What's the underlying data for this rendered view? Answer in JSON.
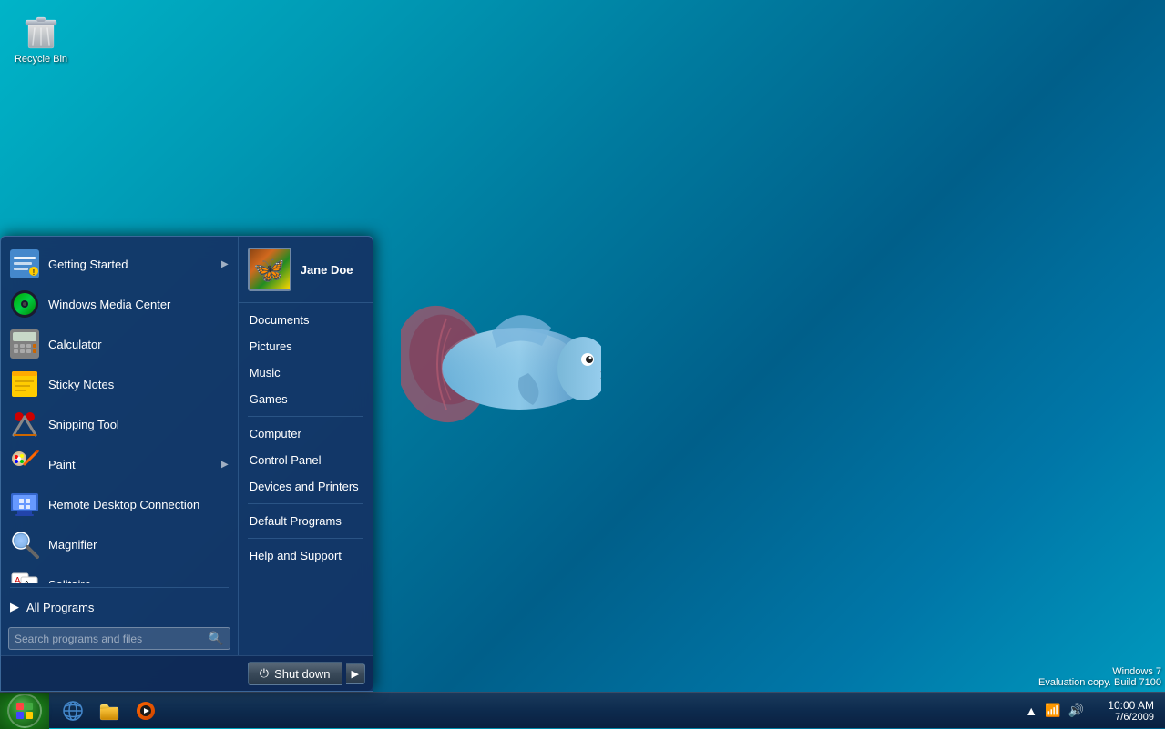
{
  "desktop": {
    "background": "Windows 7 fish wallpaper"
  },
  "recycle_bin": {
    "label": "Recycle Bin",
    "icon": "🗑"
  },
  "start_menu": {
    "user": {
      "name": "Jane Doe"
    },
    "left_items": [
      {
        "id": "getting-started",
        "label": "Getting Started",
        "icon": "📋",
        "has_arrow": true
      },
      {
        "id": "windows-media-center",
        "label": "Windows Media Center",
        "icon": "🎵",
        "has_arrow": false
      },
      {
        "id": "calculator",
        "label": "Calculator",
        "icon": "🧮",
        "has_arrow": false
      },
      {
        "id": "sticky-notes",
        "label": "Sticky Notes",
        "icon": "📝",
        "has_arrow": false
      },
      {
        "id": "snipping-tool",
        "label": "Snipping Tool",
        "icon": "✂",
        "has_arrow": false
      },
      {
        "id": "paint",
        "label": "Paint",
        "icon": "🖌",
        "has_arrow": true
      },
      {
        "id": "remote-desktop",
        "label": "Remote Desktop Connection",
        "icon": "🖥",
        "has_arrow": false
      },
      {
        "id": "magnifier",
        "label": "Magnifier",
        "icon": "🔍",
        "has_arrow": false
      },
      {
        "id": "solitaire",
        "label": "Solitaire",
        "icon": "🃏",
        "has_arrow": false
      }
    ],
    "all_programs_label": "All Programs",
    "search_placeholder": "Search programs and files",
    "right_items": [
      {
        "id": "documents",
        "label": "Documents"
      },
      {
        "id": "pictures",
        "label": "Pictures"
      },
      {
        "id": "music",
        "label": "Music"
      },
      {
        "id": "games",
        "label": "Games"
      },
      {
        "id": "computer",
        "label": "Computer"
      },
      {
        "id": "control-panel",
        "label": "Control Panel"
      },
      {
        "id": "devices-printers",
        "label": "Devices and Printers"
      },
      {
        "id": "default-programs",
        "label": "Default Programs"
      },
      {
        "id": "help-support",
        "label": "Help and Support"
      }
    ],
    "shutdown_label": "Shut down"
  },
  "taskbar": {
    "start_label": "Start",
    "pinned_icons": [
      {
        "id": "ie",
        "icon": "🌐",
        "label": "Internet Explorer"
      },
      {
        "id": "explorer",
        "icon": "📁",
        "label": "Windows Explorer"
      },
      {
        "id": "media-player",
        "icon": "▶",
        "label": "Windows Media Player"
      }
    ],
    "tray": {
      "time": "10:00 AM",
      "date": "7/6/2009"
    }
  },
  "windows_info": {
    "line1": "Windows 7",
    "line2": "Evaluation copy. Build 7100"
  }
}
